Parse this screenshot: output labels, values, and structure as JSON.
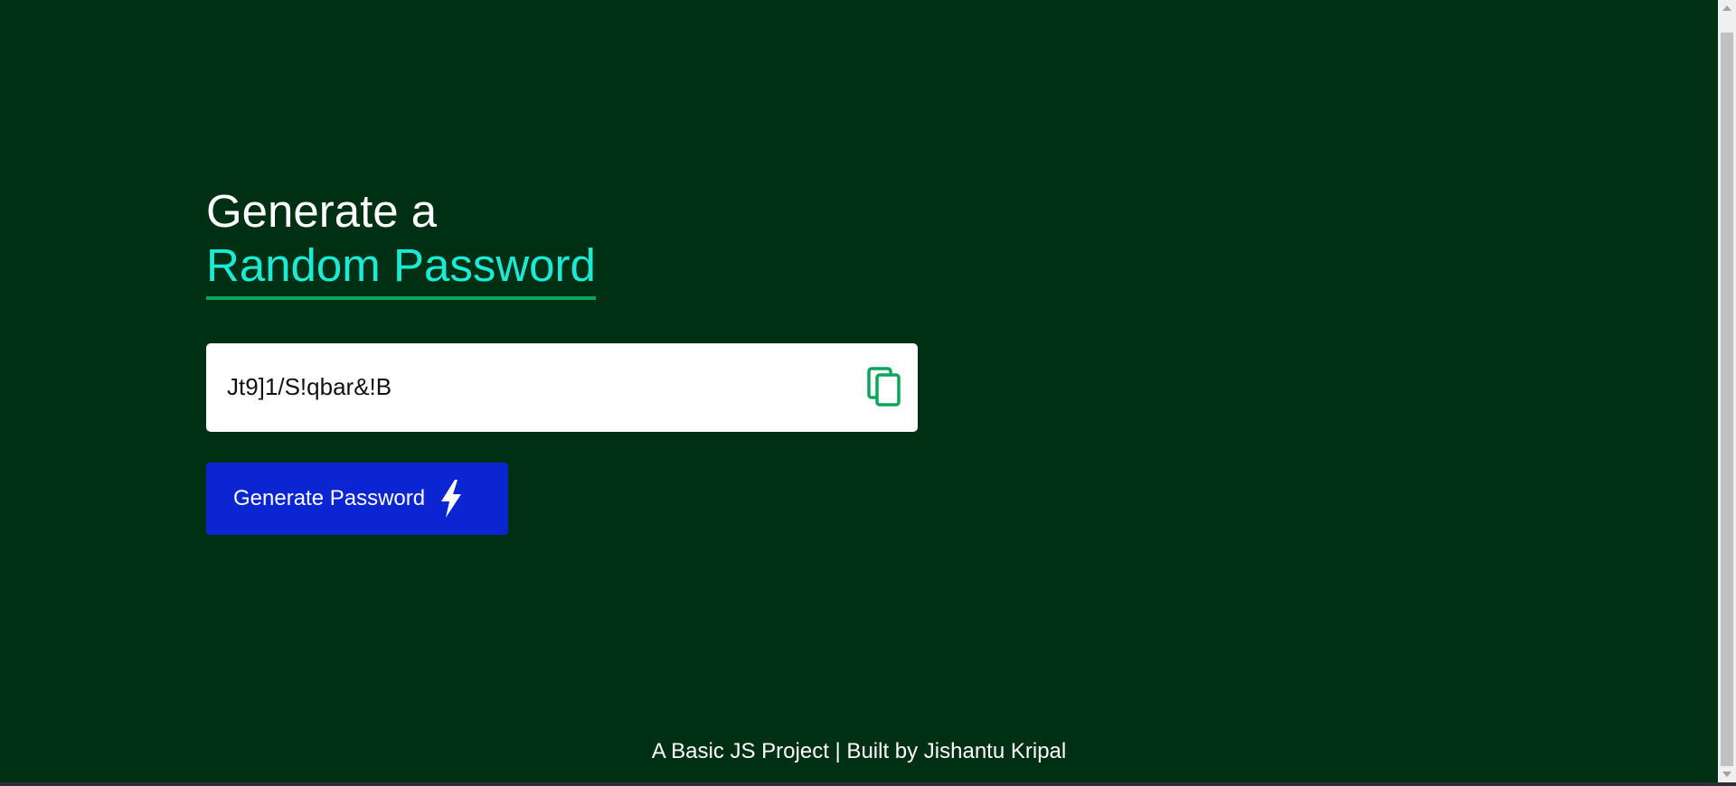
{
  "heading": {
    "line1": "Generate a",
    "line2": "Random Password"
  },
  "password_field": {
    "value": "Jt9]1/S!qbar&!B"
  },
  "copy_button": {
    "icon": "copy-icon"
  },
  "generate_button": {
    "label": "Generate Password",
    "icon": "lightning-bolt-icon"
  },
  "footer": {
    "text": "A Basic JS Project | Built by Jishantu Kripal"
  },
  "colors": {
    "background": "#003014",
    "accent_text": "#1aebd5",
    "underline": "#0aa55a",
    "button": "#0a25d1",
    "copy_icon": "#0aa55a"
  }
}
